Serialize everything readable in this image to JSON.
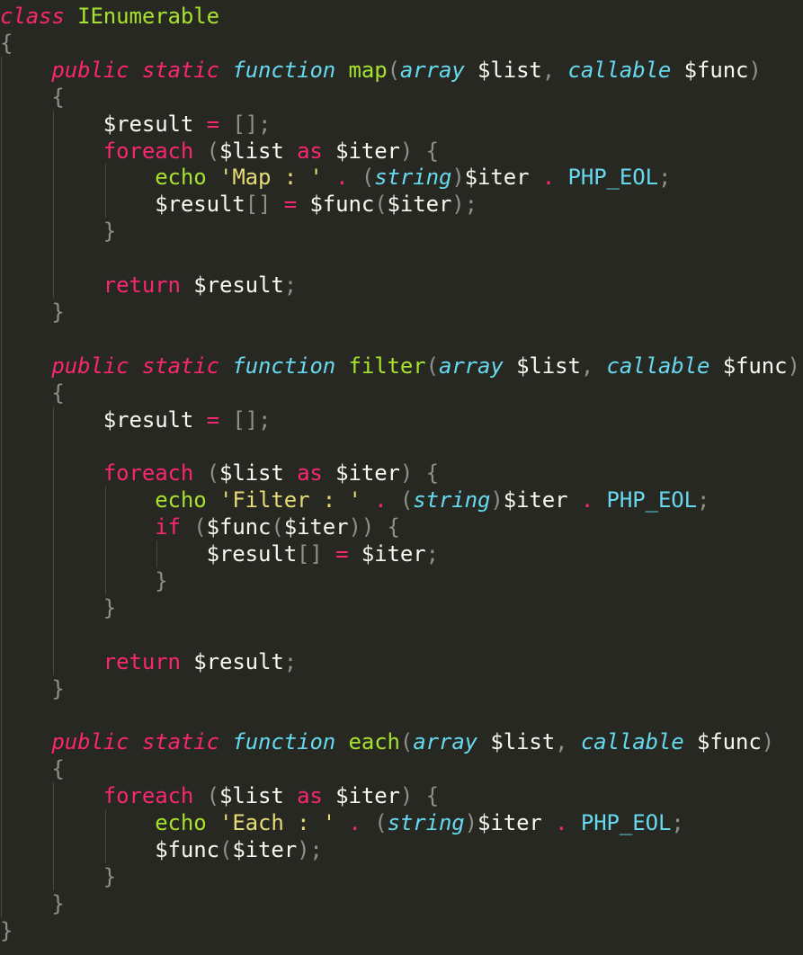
{
  "colors": {
    "background": "#272822",
    "keyword": "#f92672",
    "storage_type": "#66d9ef",
    "function_name": "#a6e22e",
    "string": "#e6db74",
    "constant": "#66d9ef",
    "variable": "#f8f8f2",
    "punctuation": "#8f908a",
    "indent_guide": "#464741"
  },
  "code": {
    "language": "PHP",
    "lines": [
      [
        [
          "kwi",
          "class"
        ],
        [
          "plain",
          " "
        ],
        [
          "cls",
          "IEnumerable"
        ]
      ],
      [
        [
          "pun",
          "{"
        ]
      ],
      [
        [
          "plain",
          "    "
        ],
        [
          "kwi",
          "public"
        ],
        [
          "plain",
          " "
        ],
        [
          "kwi",
          "static"
        ],
        [
          "plain",
          " "
        ],
        [
          "sto",
          "function"
        ],
        [
          "plain",
          " "
        ],
        [
          "fn",
          "map"
        ],
        [
          "pun",
          "("
        ],
        [
          "sto",
          "array"
        ],
        [
          "plain",
          " "
        ],
        [
          "var",
          "$list"
        ],
        [
          "pun",
          ", "
        ],
        [
          "sto",
          "callable"
        ],
        [
          "plain",
          " "
        ],
        [
          "var",
          "$func"
        ],
        [
          "pun",
          ")"
        ]
      ],
      [
        [
          "plain",
          "    "
        ],
        [
          "pun",
          "{"
        ]
      ],
      [
        [
          "plain",
          "        "
        ],
        [
          "var",
          "$result"
        ],
        [
          "plain",
          " "
        ],
        [
          "kw",
          "="
        ],
        [
          "plain",
          " "
        ],
        [
          "pun",
          "[];"
        ]
      ],
      [
        [
          "plain",
          "        "
        ],
        [
          "kw",
          "foreach"
        ],
        [
          "plain",
          " "
        ],
        [
          "pun",
          "("
        ],
        [
          "var",
          "$list"
        ],
        [
          "plain",
          " "
        ],
        [
          "kw",
          "as"
        ],
        [
          "plain",
          " "
        ],
        [
          "var",
          "$iter"
        ],
        [
          "pun",
          ") {"
        ]
      ],
      [
        [
          "plain",
          "            "
        ],
        [
          "fn",
          "echo"
        ],
        [
          "plain",
          " "
        ],
        [
          "str",
          "'Map : '"
        ],
        [
          "plain",
          " "
        ],
        [
          "kw",
          "."
        ],
        [
          "plain",
          " "
        ],
        [
          "pun",
          "("
        ],
        [
          "sto",
          "string"
        ],
        [
          "pun",
          ")"
        ],
        [
          "var",
          "$iter"
        ],
        [
          "plain",
          " "
        ],
        [
          "kw",
          "."
        ],
        [
          "plain",
          " "
        ],
        [
          "cst",
          "PHP_EOL"
        ],
        [
          "pun",
          ";"
        ]
      ],
      [
        [
          "plain",
          "            "
        ],
        [
          "var",
          "$result"
        ],
        [
          "pun",
          "[]"
        ],
        [
          "plain",
          " "
        ],
        [
          "kw",
          "="
        ],
        [
          "plain",
          " "
        ],
        [
          "var",
          "$func"
        ],
        [
          "pun",
          "("
        ],
        [
          "var",
          "$iter"
        ],
        [
          "pun",
          ");"
        ]
      ],
      [
        [
          "plain",
          "        "
        ],
        [
          "pun",
          "}"
        ]
      ],
      [],
      [
        [
          "plain",
          "        "
        ],
        [
          "kw",
          "return"
        ],
        [
          "plain",
          " "
        ],
        [
          "var",
          "$result"
        ],
        [
          "pun",
          ";"
        ]
      ],
      [
        [
          "plain",
          "    "
        ],
        [
          "pun",
          "}"
        ]
      ],
      [],
      [
        [
          "plain",
          "    "
        ],
        [
          "kwi",
          "public"
        ],
        [
          "plain",
          " "
        ],
        [
          "kwi",
          "static"
        ],
        [
          "plain",
          " "
        ],
        [
          "sto",
          "function"
        ],
        [
          "plain",
          " "
        ],
        [
          "fn",
          "filter"
        ],
        [
          "pun",
          "("
        ],
        [
          "sto",
          "array"
        ],
        [
          "plain",
          " "
        ],
        [
          "var",
          "$list"
        ],
        [
          "pun",
          ", "
        ],
        [
          "sto",
          "callable"
        ],
        [
          "plain",
          " "
        ],
        [
          "var",
          "$func"
        ],
        [
          "pun",
          ")"
        ]
      ],
      [
        [
          "plain",
          "    "
        ],
        [
          "pun",
          "{"
        ]
      ],
      [
        [
          "plain",
          "        "
        ],
        [
          "var",
          "$result"
        ],
        [
          "plain",
          " "
        ],
        [
          "kw",
          "="
        ],
        [
          "plain",
          " "
        ],
        [
          "pun",
          "[];"
        ]
      ],
      [],
      [
        [
          "plain",
          "        "
        ],
        [
          "kw",
          "foreach"
        ],
        [
          "plain",
          " "
        ],
        [
          "pun",
          "("
        ],
        [
          "var",
          "$list"
        ],
        [
          "plain",
          " "
        ],
        [
          "kw",
          "as"
        ],
        [
          "plain",
          " "
        ],
        [
          "var",
          "$iter"
        ],
        [
          "pun",
          ") {"
        ]
      ],
      [
        [
          "plain",
          "            "
        ],
        [
          "fn",
          "echo"
        ],
        [
          "plain",
          " "
        ],
        [
          "str",
          "'Filter : '"
        ],
        [
          "plain",
          " "
        ],
        [
          "kw",
          "."
        ],
        [
          "plain",
          " "
        ],
        [
          "pun",
          "("
        ],
        [
          "sto",
          "string"
        ],
        [
          "pun",
          ")"
        ],
        [
          "var",
          "$iter"
        ],
        [
          "plain",
          " "
        ],
        [
          "kw",
          "."
        ],
        [
          "plain",
          " "
        ],
        [
          "cst",
          "PHP_EOL"
        ],
        [
          "pun",
          ";"
        ]
      ],
      [
        [
          "plain",
          "            "
        ],
        [
          "kw",
          "if"
        ],
        [
          "plain",
          " "
        ],
        [
          "pun",
          "("
        ],
        [
          "var",
          "$func"
        ],
        [
          "pun",
          "("
        ],
        [
          "var",
          "$iter"
        ],
        [
          "pun",
          ")) {"
        ]
      ],
      [
        [
          "plain",
          "                "
        ],
        [
          "var",
          "$result"
        ],
        [
          "pun",
          "[]"
        ],
        [
          "plain",
          " "
        ],
        [
          "kw",
          "="
        ],
        [
          "plain",
          " "
        ],
        [
          "var",
          "$iter"
        ],
        [
          "pun",
          ";"
        ]
      ],
      [
        [
          "plain",
          "            "
        ],
        [
          "pun",
          "}"
        ]
      ],
      [
        [
          "plain",
          "        "
        ],
        [
          "pun",
          "}"
        ]
      ],
      [],
      [
        [
          "plain",
          "        "
        ],
        [
          "kw",
          "return"
        ],
        [
          "plain",
          " "
        ],
        [
          "var",
          "$result"
        ],
        [
          "pun",
          ";"
        ]
      ],
      [
        [
          "plain",
          "    "
        ],
        [
          "pun",
          "}"
        ]
      ],
      [],
      [
        [
          "plain",
          "    "
        ],
        [
          "kwi",
          "public"
        ],
        [
          "plain",
          " "
        ],
        [
          "kwi",
          "static"
        ],
        [
          "plain",
          " "
        ],
        [
          "sto",
          "function"
        ],
        [
          "plain",
          " "
        ],
        [
          "fn",
          "each"
        ],
        [
          "pun",
          "("
        ],
        [
          "sto",
          "array"
        ],
        [
          "plain",
          " "
        ],
        [
          "var",
          "$list"
        ],
        [
          "pun",
          ", "
        ],
        [
          "sto",
          "callable"
        ],
        [
          "plain",
          " "
        ],
        [
          "var",
          "$func"
        ],
        [
          "pun",
          ")"
        ]
      ],
      [
        [
          "plain",
          "    "
        ],
        [
          "pun",
          "{"
        ]
      ],
      [
        [
          "plain",
          "        "
        ],
        [
          "kw",
          "foreach"
        ],
        [
          "plain",
          " "
        ],
        [
          "pun",
          "("
        ],
        [
          "var",
          "$list"
        ],
        [
          "plain",
          " "
        ],
        [
          "kw",
          "as"
        ],
        [
          "plain",
          " "
        ],
        [
          "var",
          "$iter"
        ],
        [
          "pun",
          ") {"
        ]
      ],
      [
        [
          "plain",
          "            "
        ],
        [
          "fn",
          "echo"
        ],
        [
          "plain",
          " "
        ],
        [
          "str",
          "'Each : '"
        ],
        [
          "plain",
          " "
        ],
        [
          "kw",
          "."
        ],
        [
          "plain",
          " "
        ],
        [
          "pun",
          "("
        ],
        [
          "sto",
          "string"
        ],
        [
          "pun",
          ")"
        ],
        [
          "var",
          "$iter"
        ],
        [
          "plain",
          " "
        ],
        [
          "kw",
          "."
        ],
        [
          "plain",
          " "
        ],
        [
          "cst",
          "PHP_EOL"
        ],
        [
          "pun",
          ";"
        ]
      ],
      [
        [
          "plain",
          "            "
        ],
        [
          "var",
          "$func"
        ],
        [
          "pun",
          "("
        ],
        [
          "var",
          "$iter"
        ],
        [
          "pun",
          ");"
        ]
      ],
      [
        [
          "plain",
          "        "
        ],
        [
          "pun",
          "}"
        ]
      ],
      [
        [
          "plain",
          "    "
        ],
        [
          "pun",
          "}"
        ]
      ],
      [
        [
          "pun",
          "}"
        ]
      ]
    ]
  }
}
